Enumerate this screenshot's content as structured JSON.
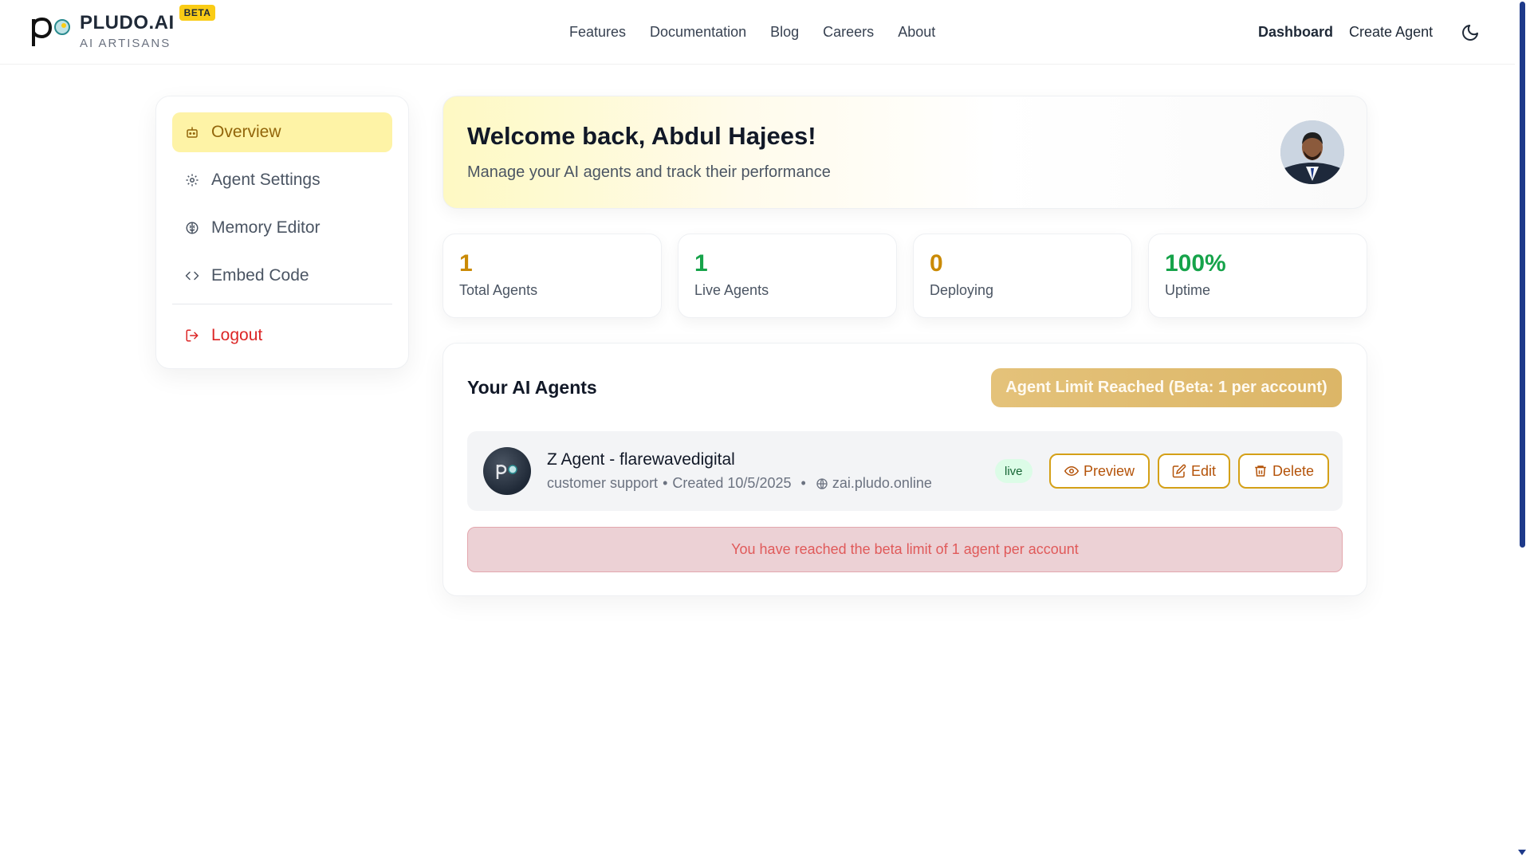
{
  "brand": {
    "name": "PLUDO.AI",
    "badge": "BETA",
    "tagline": "AI ARTISANS"
  },
  "nav": {
    "items": [
      "Features",
      "Documentation",
      "Blog",
      "Careers",
      "About"
    ],
    "right": [
      "Dashboard",
      "Create Agent"
    ]
  },
  "sidebar": {
    "items": [
      {
        "label": "Overview",
        "icon": "robot-icon"
      },
      {
        "label": "Agent Settings",
        "icon": "gear-icon"
      },
      {
        "label": "Memory Editor",
        "icon": "brain-icon"
      },
      {
        "label": "Embed Code",
        "icon": "code-icon"
      }
    ],
    "logout": "Logout"
  },
  "welcome": {
    "title": "Welcome back, Abdul Hajees!",
    "subtitle": "Manage your AI agents and track their performance"
  },
  "stats": [
    {
      "value": "1",
      "label": "Total Agents",
      "color": "#ca8a04"
    },
    {
      "value": "1",
      "label": "Live Agents",
      "color": "#16a34a"
    },
    {
      "value": "0",
      "label": "Deploying",
      "color": "#ca8a04"
    },
    {
      "value": "100%",
      "label": "Uptime",
      "color": "#16a34a"
    }
  ],
  "agents": {
    "title": "Your AI Agents",
    "limit_button": "Agent Limit Reached (Beta: 1 per account)",
    "list": [
      {
        "name": "Z Agent - flarewavedigital",
        "category": "customer support",
        "created": "Created 10/5/2025",
        "domain": "zai.pludo.online",
        "status": "live"
      }
    ],
    "actions": {
      "preview": "Preview",
      "edit": "Edit",
      "delete": "Delete"
    },
    "warning": "You have reached the beta limit of 1 agent per account"
  }
}
